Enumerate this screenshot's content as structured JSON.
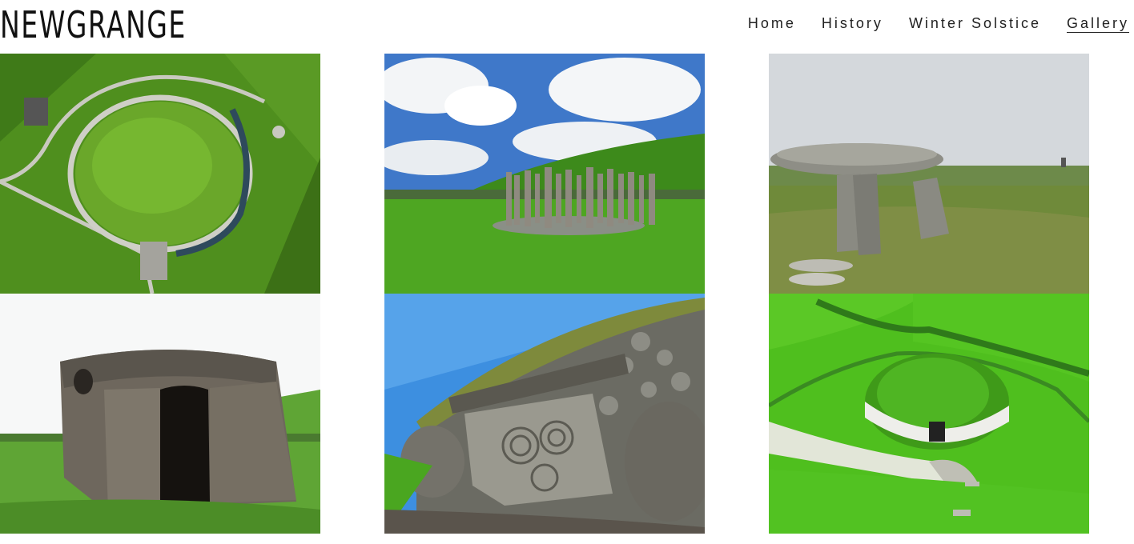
{
  "header": {
    "brand": "NEWGRANGE",
    "nav": [
      {
        "label": "Home",
        "active": false
      },
      {
        "label": "History",
        "active": false
      },
      {
        "label": "Winter Solstice",
        "active": false
      },
      {
        "label": "Gallery",
        "active": true
      }
    ]
  },
  "gallery": {
    "photos": [
      {
        "subject": "aerial view of Newgrange mound"
      },
      {
        "subject": "timber circle beside the mound"
      },
      {
        "subject": "stone dolmen on grassland"
      },
      {
        "subject": "beehive stone structure"
      },
      {
        "subject": "carved entrance kerbstone with spirals"
      },
      {
        "subject": "aerial view of Newgrange with white quartz facade"
      }
    ]
  }
}
